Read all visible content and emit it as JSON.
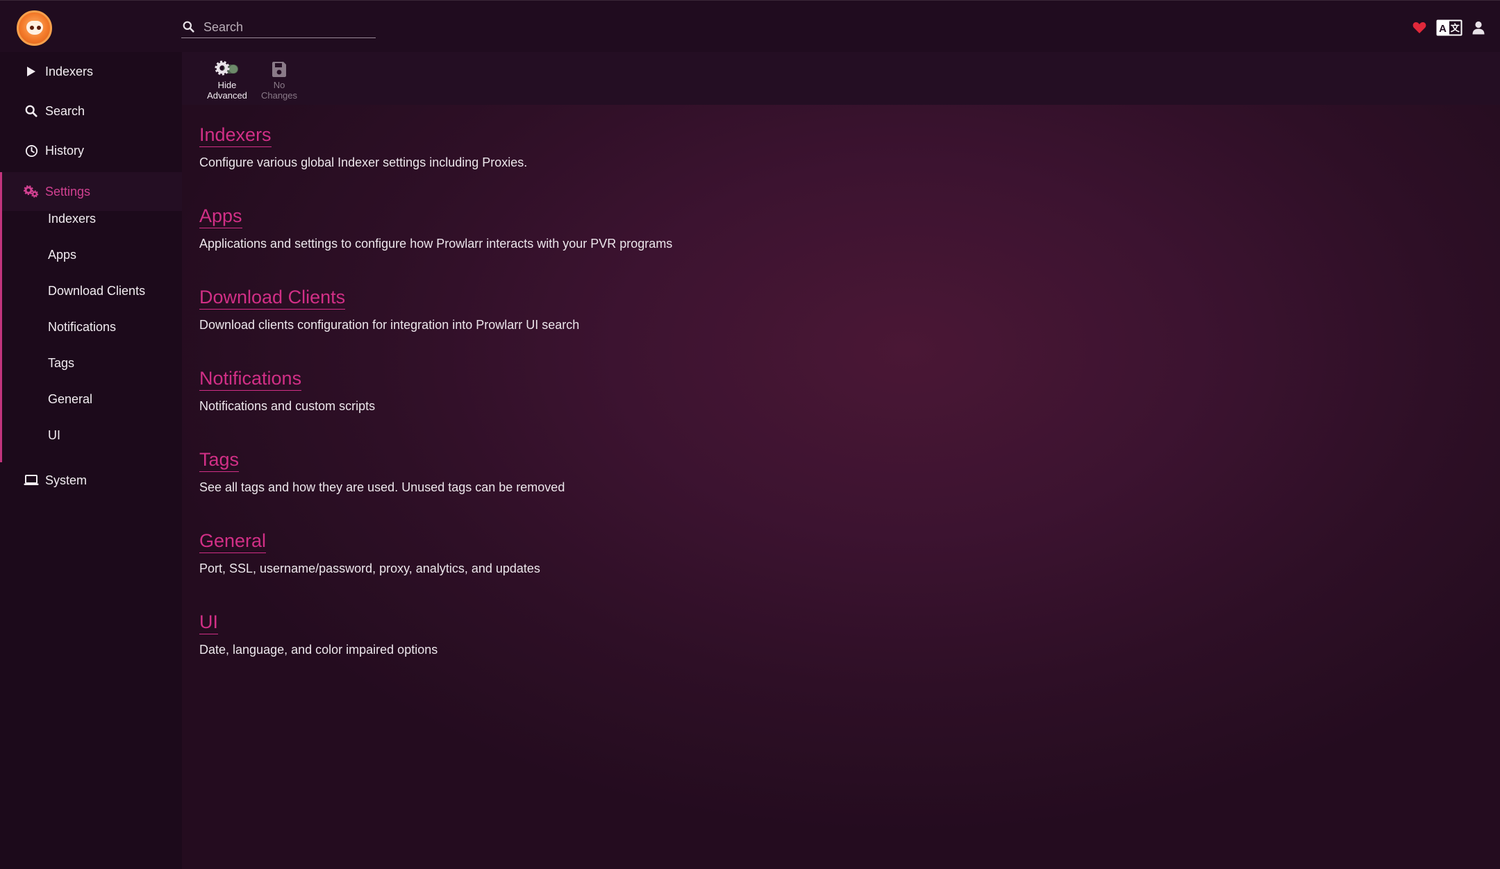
{
  "search": {
    "placeholder": "Search"
  },
  "sidebar": {
    "items": [
      {
        "label": "Indexers",
        "icon": "play-icon"
      },
      {
        "label": "Search",
        "icon": "search-icon"
      },
      {
        "label": "History",
        "icon": "clock-icon"
      },
      {
        "label": "Settings",
        "icon": "cogs-icon"
      },
      {
        "label": "System",
        "icon": "laptop-icon"
      }
    ],
    "settings_subitems": [
      {
        "label": "Indexers"
      },
      {
        "label": "Apps"
      },
      {
        "label": "Download Clients"
      },
      {
        "label": "Notifications"
      },
      {
        "label": "Tags"
      },
      {
        "label": "General"
      },
      {
        "label": "UI"
      }
    ]
  },
  "toolbar": {
    "hide_advanced_line1": "Hide",
    "hide_advanced_line2": "Advanced",
    "no_changes_line1": "No",
    "no_changes_line2": "Changes"
  },
  "sections": [
    {
      "title": "Indexers",
      "description": "Configure various global Indexer settings including Proxies."
    },
    {
      "title": "Apps",
      "description": "Applications and settings to configure how Prowlarr interacts with your PVR programs"
    },
    {
      "title": "Download Clients",
      "description": "Download clients configuration for integration into Prowlarr UI search"
    },
    {
      "title": "Notifications",
      "description": "Notifications and custom scripts"
    },
    {
      "title": "Tags",
      "description": "See all tags and how they are used. Unused tags can be removed"
    },
    {
      "title": "General",
      "description": "Port, SSL, username/password, proxy, analytics, and updates"
    },
    {
      "title": "UI",
      "description": "Date, language, and color impaired options"
    }
  ],
  "colors": {
    "accent": "#d12f86",
    "heart": "#e0283a",
    "background": "#1d0b1c"
  },
  "top_icons": [
    "heart-icon",
    "translate-icon",
    "user-icon"
  ]
}
